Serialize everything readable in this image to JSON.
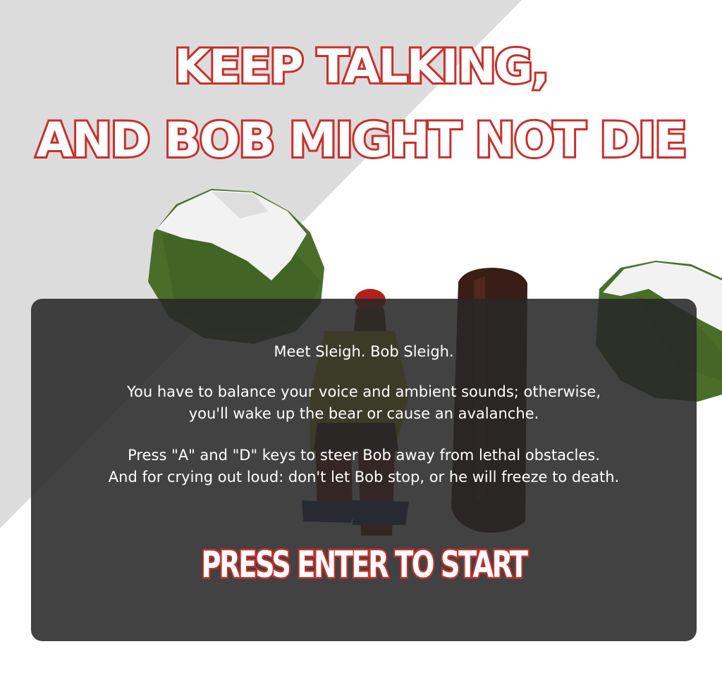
{
  "title": {
    "line1": "Keep Talking,",
    "line2": "and Bob Might not Die"
  },
  "intro": {
    "tagline": "Meet Sleigh. Bob Sleigh.",
    "balance_line1": "You have to balance your voice and ambient sounds; otherwise,",
    "balance_line2": "you'll wake up the bear or cause an avalanche.",
    "controls_line1": "Press \"A\" and \"D\" keys to steer Bob away from lethal obstacles.",
    "controls_line2": "And for crying out loud: don't let Bob stop, or he will freeze to death."
  },
  "start_prompt": "Press Enter to Start",
  "colors": {
    "title_outline": "#c8302c",
    "title_fill": "#ffffff",
    "dialog_bg": "#282828",
    "snow_shadow": "#dedede",
    "bush_green": "#4a6e2a",
    "snow_cap": "#f2f2f2",
    "log_brown": "#3a1d14",
    "hat_red": "#b3201d",
    "jacket_yellow": "#c9c72a",
    "pants_red": "#8a1c16",
    "sled_blue": "#2c3e80"
  },
  "scene_objects": [
    "bush-with-snow-left",
    "bush-with-snow-right",
    "log-obstacle",
    "bob-sledding"
  ]
}
